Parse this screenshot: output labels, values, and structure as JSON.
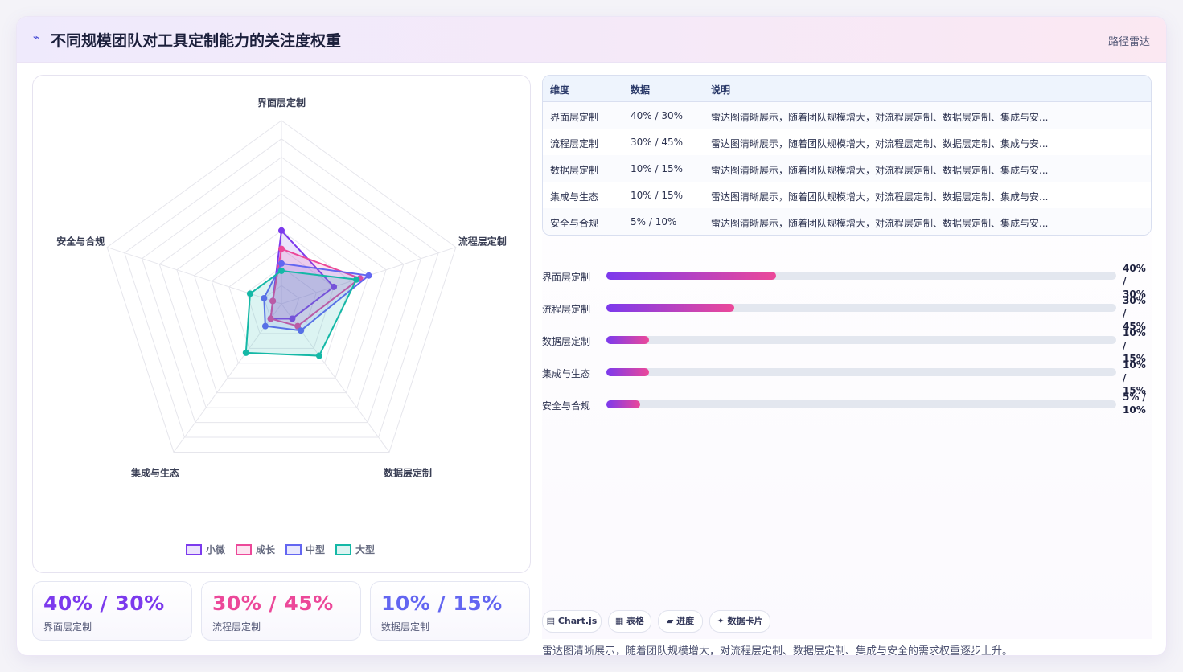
{
  "header": {
    "icon": "trend-icon",
    "title": "不同规模团队对工具定制能力的关注度权重",
    "tag": "路径雷达"
  },
  "chart_data": {
    "type": "radar",
    "axes": [
      "界面层定制",
      "流程层定制",
      "数据层定制",
      "集成与生态",
      "安全与合规"
    ],
    "rmax": 100,
    "rings": 10,
    "series": [
      {
        "name": "小微",
        "color": "#7c3aed",
        "values": [
          40,
          30,
          10,
          10,
          5
        ]
      },
      {
        "name": "成长",
        "color": "#ec4899",
        "values": [
          30,
          45,
          15,
          10,
          5
        ]
      },
      {
        "name": "中型",
        "color": "#6366f1",
        "values": [
          22,
          50,
          18,
          15,
          10
        ]
      },
      {
        "name": "大型",
        "color": "#14b8a6",
        "values": [
          18,
          43,
          35,
          33,
          18
        ]
      }
    ]
  },
  "table": {
    "headers": [
      "维度",
      "数据",
      "说明"
    ],
    "rows": [
      [
        "界面层定制",
        "40% / 30%",
        "雷达图清晰展示，随着团队规模增大，对流程层定制、数据层定制、集成与安..."
      ],
      [
        "流程层定制",
        "30% / 45%",
        "雷达图清晰展示，随着团队规模增大，对流程层定制、数据层定制、集成与安..."
      ],
      [
        "数据层定制",
        "10% / 15%",
        "雷达图清晰展示，随着团队规模增大，对流程层定制、数据层定制、集成与安..."
      ],
      [
        "集成与生态",
        "10% / 15%",
        "雷达图清晰展示，随着团队规模增大，对流程层定制、数据层定制、集成与安..."
      ],
      [
        "安全与合规",
        "5% / 10%",
        "雷达图清晰展示，随着团队规模增大，对流程层定制、数据层定制、集成与安..."
      ]
    ]
  },
  "progress": [
    {
      "label": "界面层定制",
      "value_text": "40% / 30%",
      "fill_pct": 33.3
    },
    {
      "label": "流程层定制",
      "value_text": "30% / 45%",
      "fill_pct": 25
    },
    {
      "label": "数据层定制",
      "value_text": "10% / 15%",
      "fill_pct": 8.3
    },
    {
      "label": "集成与生态",
      "value_text": "10% / 15%",
      "fill_pct": 8.3
    },
    {
      "label": "安全与合规",
      "value_text": "5% / 10%",
      "fill_pct": 6.7
    }
  ],
  "stats": [
    {
      "value": "40% / 30%",
      "label": "界面层定制",
      "color": "#7c3aed"
    },
    {
      "value": "30% / 45%",
      "label": "流程层定制",
      "color": "#ec4899"
    },
    {
      "value": "10% / 15%",
      "label": "数据层定制",
      "color": "#6366f1"
    }
  ],
  "chips": [
    "▤ Chart.js",
    "▦ 表格",
    "▰ 进度",
    "✦ 数据卡片"
  ],
  "note": "雷达图清晰展示，随着团队规模增大，对流程层定制、数据层定制、集成与安全的需求权重逐步上升。"
}
